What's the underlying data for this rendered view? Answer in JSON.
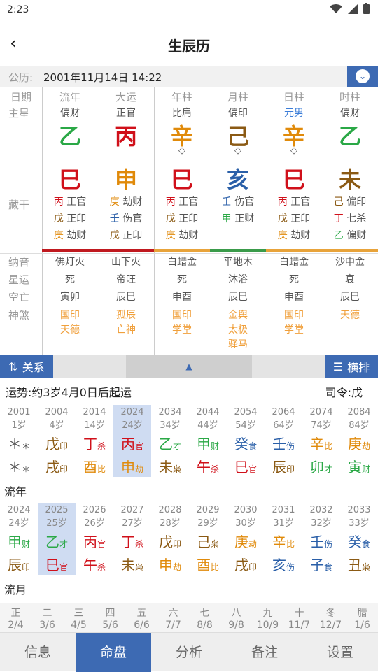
{
  "status": {
    "time": "2:23"
  },
  "header": {
    "title": "生辰历"
  },
  "date": {
    "label": "公历:",
    "value": "2001年11月14日 14:22"
  },
  "cols": [
    "日期",
    "流年",
    "大运",
    "年柱",
    "月柱",
    "日柱",
    "时柱"
  ],
  "zhuxing": {
    "label": "主星",
    "vals": [
      "偏财",
      "正官",
      "比肩",
      "偏印",
      "元男",
      "偏财"
    ]
  },
  "gan": [
    "乙",
    "丙",
    "辛",
    "己",
    "辛",
    "乙"
  ],
  "diamond": "◇",
  "zhi": [
    "巳",
    "申",
    "巳",
    "亥",
    "巳",
    "未"
  ],
  "canggan": {
    "label": "藏干",
    "cols": [
      [
        [
          "丙",
          "正官"
        ],
        [
          "戊",
          "正印"
        ],
        [
          "庚",
          "劫财"
        ]
      ],
      [
        [
          "庚",
          "劫财"
        ],
        [
          "壬",
          "伤官"
        ],
        [
          "戊",
          "正印"
        ]
      ],
      [
        [
          "丙",
          "正官"
        ],
        [
          "戊",
          "正印"
        ],
        [
          "庚",
          "劫财"
        ]
      ],
      [
        [
          "壬",
          "伤官"
        ],
        [
          "甲",
          "正财"
        ]
      ],
      [
        [
          "丙",
          "正官"
        ],
        [
          "戊",
          "正印"
        ],
        [
          "庚",
          "劫财"
        ]
      ],
      [
        [
          "己",
          "偏印"
        ],
        [
          "丁",
          "七杀"
        ],
        [
          "乙",
          "偏财"
        ]
      ]
    ]
  },
  "nayin": {
    "label": "纳音",
    "vals": [
      "佛灯火",
      "山下火",
      "白蜡金",
      "平地木",
      "白蜡金",
      "沙中金"
    ]
  },
  "xingyun": {
    "label": "星运",
    "vals": [
      "死",
      "帝旺",
      "死",
      "沐浴",
      "死",
      "衰"
    ]
  },
  "kongwang": {
    "label": "空亡",
    "vals": [
      "寅卯",
      "辰巳",
      "申酉",
      "辰巳",
      "申酉",
      "辰巳"
    ]
  },
  "shensha": {
    "label": "神煞",
    "cols": [
      [
        "国印",
        "天德"
      ],
      [
        "孤辰",
        "亡神"
      ],
      [
        "国印",
        "学堂"
      ],
      [
        "金舆",
        "太极",
        "驿马"
      ],
      [
        "国印",
        "学堂"
      ],
      [
        "天德"
      ]
    ]
  },
  "toolbar": {
    "left": "关系",
    "right": "横排",
    "mid": "▲"
  },
  "yunshi": "运势:约3岁4月0日后起运",
  "siling": "司令:戊",
  "dayun": [
    {
      "y": "2001",
      "a": "1岁",
      "g": "＊",
      "gs": "＊",
      "z": "＊",
      "zs": "＊",
      "gc": "gy",
      "zc": "gy"
    },
    {
      "y": "2004",
      "a": "4岁",
      "g": "戊",
      "gs": "印",
      "z": "戌",
      "zs": "印",
      "gc": "br",
      "zc": "br"
    },
    {
      "y": "2014",
      "a": "14岁",
      "g": "丁",
      "gs": "杀",
      "z": "酉",
      "zs": "比",
      "gc": "r",
      "zc": "o"
    },
    {
      "y": "2024",
      "a": "24岁",
      "g": "丙",
      "gs": "官",
      "z": "申",
      "zs": "劫",
      "gc": "r",
      "zc": "o"
    },
    {
      "y": "2034",
      "a": "34岁",
      "g": "乙",
      "gs": "才",
      "z": "未",
      "zs": "枭",
      "gc": "g",
      "zc": "br"
    },
    {
      "y": "2044",
      "a": "44岁",
      "g": "甲",
      "gs": "财",
      "z": "午",
      "zs": "杀",
      "gc": "g",
      "zc": "r"
    },
    {
      "y": "2054",
      "a": "54岁",
      "g": "癸",
      "gs": "食",
      "z": "巳",
      "zs": "官",
      "gc": "b",
      "zc": "r"
    },
    {
      "y": "2064",
      "a": "64岁",
      "g": "壬",
      "gs": "伤",
      "z": "辰",
      "zs": "印",
      "gc": "b",
      "zc": "br"
    },
    {
      "y": "2074",
      "a": "74岁",
      "g": "辛",
      "gs": "比",
      "z": "卯",
      "zs": "才",
      "gc": "o",
      "zc": "g"
    },
    {
      "y": "2084",
      "a": "84岁",
      "g": "庚",
      "gs": "劫",
      "z": "寅",
      "zs": "财",
      "gc": "o",
      "zc": "g"
    }
  ],
  "liunian_label": "流年",
  "liunian": [
    {
      "y": "2024",
      "a": "24岁",
      "g": "甲",
      "gs": "财",
      "z": "辰",
      "zs": "印",
      "gc": "g",
      "zc": "br"
    },
    {
      "y": "2025",
      "a": "25岁",
      "g": "乙",
      "gs": "才",
      "z": "巳",
      "zs": "官",
      "gc": "g",
      "zc": "r"
    },
    {
      "y": "2026",
      "a": "26岁",
      "g": "丙",
      "gs": "官",
      "z": "午",
      "zs": "杀",
      "gc": "r",
      "zc": "r"
    },
    {
      "y": "2027",
      "a": "27岁",
      "g": "丁",
      "gs": "杀",
      "z": "未",
      "zs": "枭",
      "gc": "r",
      "zc": "br"
    },
    {
      "y": "2028",
      "a": "28岁",
      "g": "戊",
      "gs": "印",
      "z": "申",
      "zs": "劫",
      "gc": "br",
      "zc": "o"
    },
    {
      "y": "2029",
      "a": "29岁",
      "g": "己",
      "gs": "枭",
      "z": "酉",
      "zs": "比",
      "gc": "br",
      "zc": "o"
    },
    {
      "y": "2030",
      "a": "30岁",
      "g": "庚",
      "gs": "劫",
      "z": "戌",
      "zs": "印",
      "gc": "o",
      "zc": "br"
    },
    {
      "y": "2031",
      "a": "31岁",
      "g": "辛",
      "gs": "比",
      "z": "亥",
      "zs": "伤",
      "gc": "o",
      "zc": "b"
    },
    {
      "y": "2032",
      "a": "32岁",
      "g": "壬",
      "gs": "伤",
      "z": "子",
      "zs": "食",
      "gc": "b",
      "zc": "b"
    },
    {
      "y": "2033",
      "a": "33岁",
      "g": "癸",
      "gs": "食",
      "z": "丑",
      "zs": "枭",
      "gc": "b",
      "zc": "br"
    }
  ],
  "liuyue_label": "流月",
  "liuyue": [
    [
      "正",
      "2/4"
    ],
    [
      "二",
      "3/6"
    ],
    [
      "三",
      "4/5"
    ],
    [
      "四",
      "5/6"
    ],
    [
      "五",
      "6/6"
    ],
    [
      "六",
      "7/7"
    ],
    [
      "七",
      "8/8"
    ],
    [
      "八",
      "9/8"
    ],
    [
      "九",
      "10/9"
    ],
    [
      "十",
      "11/7"
    ],
    [
      "冬",
      "12/7"
    ],
    [
      "腊",
      "1/6"
    ]
  ],
  "tabs": [
    "信息",
    "命盘",
    "分析",
    "备注",
    "设置"
  ],
  "colors": {
    "accent": "#3d6ab3"
  }
}
